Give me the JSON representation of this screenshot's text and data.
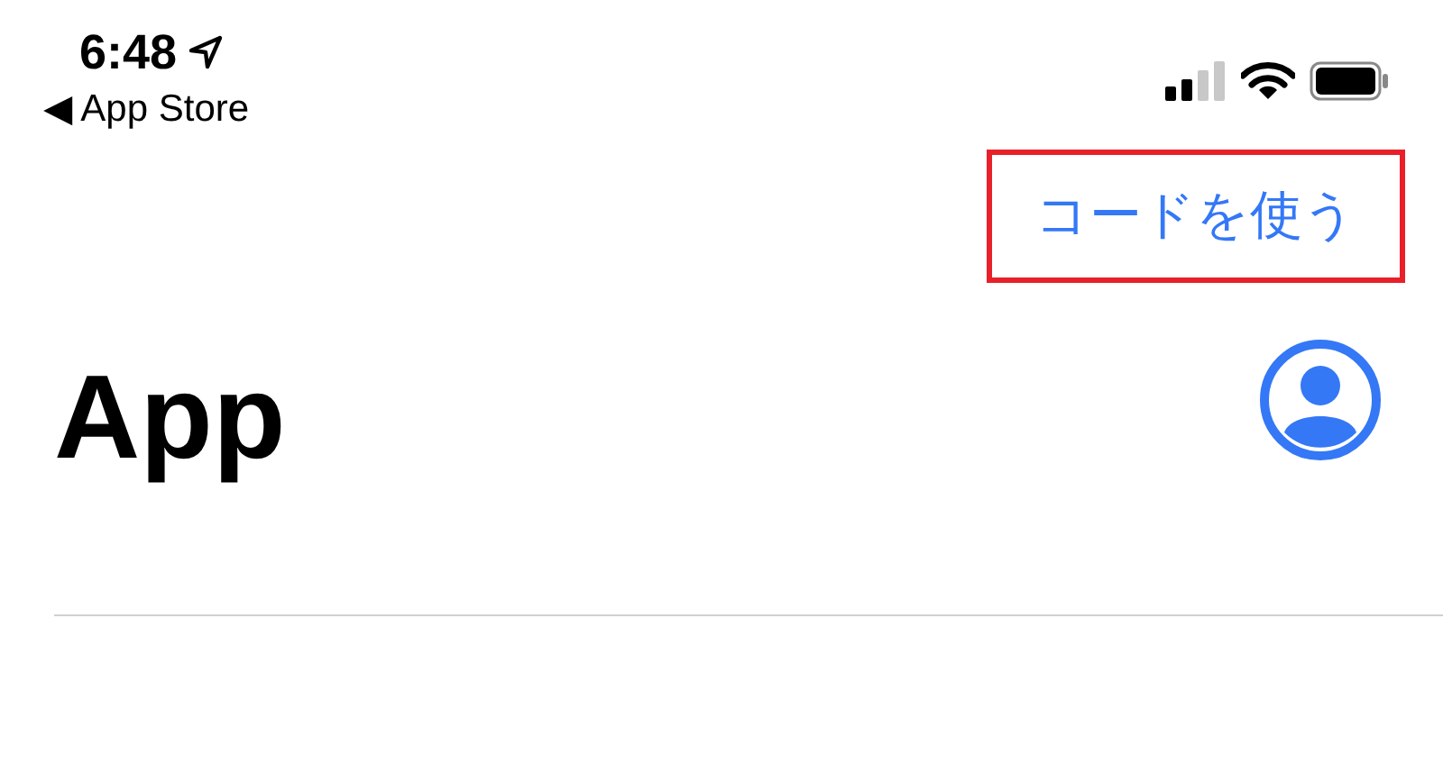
{
  "status_bar": {
    "time": "6:48",
    "back_label": "◀ App Store"
  },
  "header": {
    "action": {
      "label": "コードを使う",
      "highlighted": true
    },
    "title": "App"
  }
}
